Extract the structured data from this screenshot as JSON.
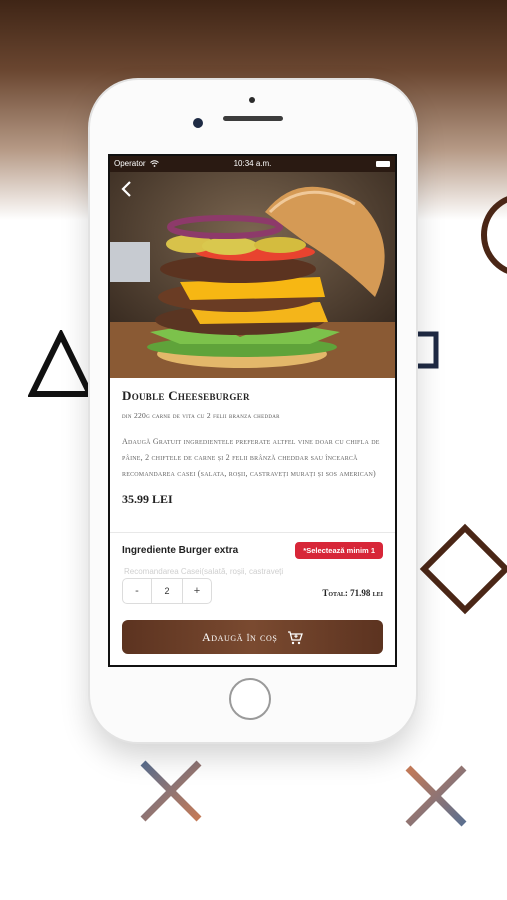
{
  "status_bar": {
    "carrier": "Operator",
    "time": "10:34 a.m."
  },
  "product": {
    "title": "Double Cheeseburger",
    "subtitle": "din 220g carne de vita cu 2 felii branza cheddar",
    "description": "Adaugă Gratuit ingredientele preferate altfel vine doar cu chifla de pâine, 2 chiftele de carne și 2 felii brânză cheddar sau încearcă recomandarea casei (salata, roșii, castraveți murați și sos american)",
    "price": "35.99 LEI"
  },
  "extras": {
    "title": "Ingrediente Burger extra",
    "badge": "*Selectează minim 1",
    "faded_option": "Recomandarea Casei(salată, roșii, castraveți"
  },
  "quantity": {
    "minus": "-",
    "value": "2",
    "plus": "+"
  },
  "total": "Total: 71.98 lei",
  "add_button_label": "Adaugă în coș",
  "colors": {
    "accent_brown": "#6b3f28",
    "badge_red": "#d72638",
    "status_bar": "#2a1a12"
  },
  "icons": [
    "back-arrow-icon",
    "wifi-icon",
    "battery-icon",
    "cart-add-icon"
  ]
}
